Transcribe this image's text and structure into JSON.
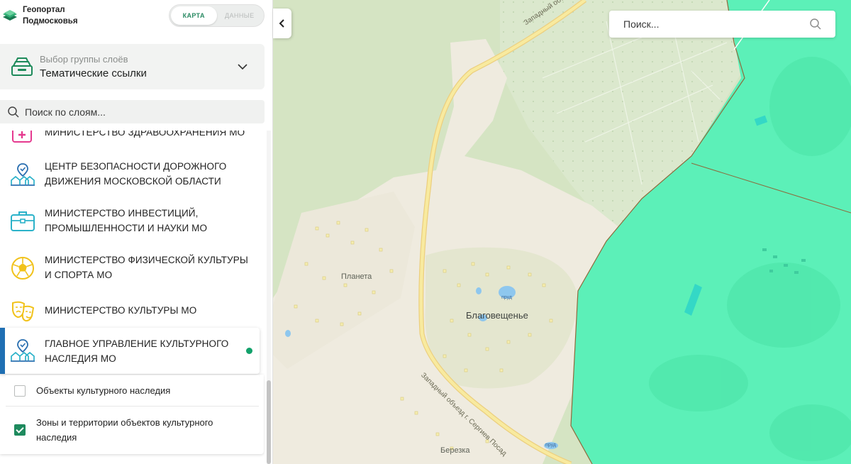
{
  "app": {
    "title": "Геопортал Подмосковья",
    "title_line1": "Геопортал",
    "title_line2": "Подмосковья"
  },
  "mode_toggle": {
    "map_label": "КАРТА",
    "data_label": "ДАННЫЕ",
    "active": "map"
  },
  "group_select": {
    "label": "Выбор группы слоёв",
    "value": "Тематические ссылки",
    "icon": "layers-box-icon"
  },
  "layer_search": {
    "placeholder": "Поиск по слоям..."
  },
  "layer_items": [
    {
      "label": "МИНИСТЕРСТВО ЗДРАВООХРАНЕНИЯ МО",
      "icon": "medical-case-icon",
      "color": "#e5398f"
    },
    {
      "label": "ЦЕНТР БЕЗОПАСНОСТИ ДОРОЖНОГО ДВИЖЕНИЯ МОСКОВСКОЙ ОБЛАСТИ",
      "icon": "location-buildings-icon",
      "color": "#2a6fb0"
    },
    {
      "label": "МИНИСТЕРСТВО ИНВЕСТИЦИЙ, ПРОМЫШЛЕННОСТИ И НАУКИ МО",
      "icon": "briefcase-icon",
      "color": "#2bb2c9"
    },
    {
      "label": "МИНИСТЕРСТВО ФИЗИЧЕСКОЙ КУЛЬТУРЫ И СПОРТА МО",
      "icon": "football-icon",
      "color": "#f1c21b"
    },
    {
      "label": "МИНИСТЕРСТВО КУЛЬТУРЫ МО",
      "icon": "theater-masks-icon",
      "color": "#f1c21b"
    },
    {
      "label": "ГЛАВНОЕ УПРАВЛЕНИЕ КУЛЬТУРНОГО НАСЛЕДИЯ МО",
      "icon": "location-buildings-icon",
      "color": "#2a6fb0",
      "selected": true,
      "active": true
    }
  ],
  "sublayers": [
    {
      "label": "Объекты культурного наследия",
      "checked": false
    },
    {
      "label": "Зоны и территории объектов культурного наследия",
      "checked": true
    }
  ],
  "map": {
    "search_placeholder": "Поиск...",
    "places": {
      "planeta": "Планета",
      "blagoveshchenye": "Благовещенье",
      "berezka": "Березка"
    },
    "road_labels": {
      "top": "Западный объезд",
      "main": "Западный объезд г. Сергиев Посад"
    },
    "pond_label": "пруд",
    "colors": {
      "zone_fill": "#5cf0b8",
      "zone_border": "#8d6a3c",
      "forest": "#d7e6c7",
      "settlement": "#efebdf",
      "road": "#f7e8a8",
      "water": "#8ec7ee"
    }
  }
}
